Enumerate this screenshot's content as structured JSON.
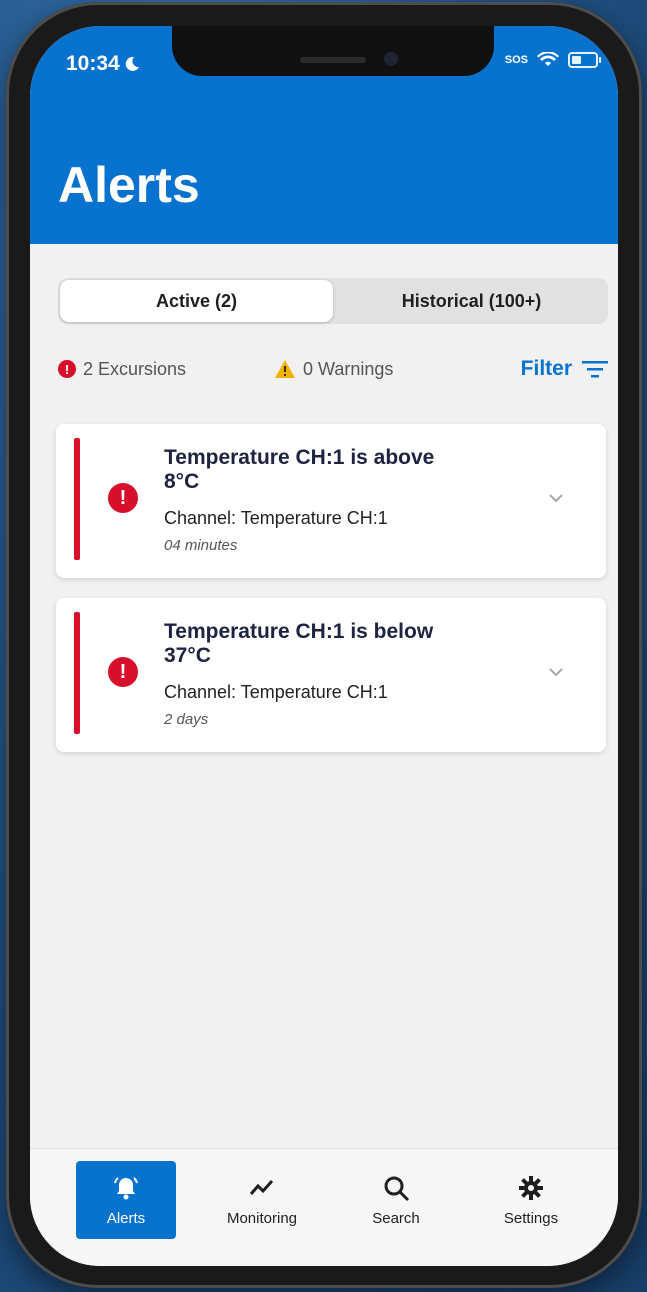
{
  "status_bar": {
    "time": "10:34",
    "sos": "SOS"
  },
  "header": {
    "title": "Alerts"
  },
  "tabs": [
    {
      "label": "Active (2)",
      "active": true
    },
    {
      "label": "Historical (100+)",
      "active": false
    }
  ],
  "summary": {
    "excursions": "2 Excursions",
    "warnings": "0 Warnings",
    "filter": "Filter"
  },
  "alerts": [
    {
      "title": "Temperature CH:1 is above 8°C",
      "channel": "Channel: Temperature CH:1",
      "time": "04 minutes"
    },
    {
      "title": "Temperature CH:1 is below 37°C",
      "channel": "Channel: Temperature CH:1",
      "time": "2 days"
    }
  ],
  "nav": [
    {
      "label": "Alerts",
      "icon": "bell-icon",
      "active": true
    },
    {
      "label": "Monitoring",
      "icon": "trend-icon",
      "active": false
    },
    {
      "label": "Search",
      "icon": "search-icon",
      "active": false
    },
    {
      "label": "Settings",
      "icon": "gear-icon",
      "active": false
    }
  ],
  "colors": {
    "brand": "#0872cf",
    "alert": "#d70f2a",
    "warning": "#f2b200"
  }
}
